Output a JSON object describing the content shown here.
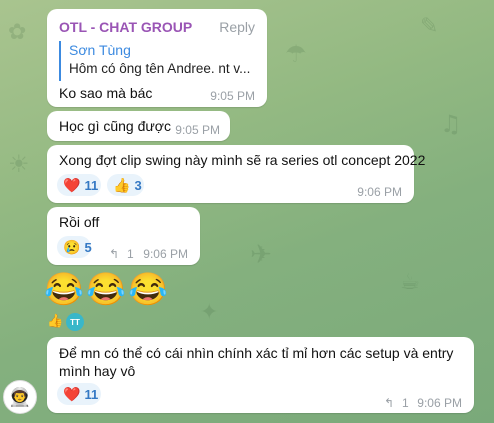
{
  "chat": {
    "messages": [
      {
        "sender": "OTL - CHAT GROUP",
        "reply_label": "Reply",
        "quote": {
          "name": "Sơn Tùng",
          "text": "Hôm có ông tên Andree. nt v..."
        },
        "text": "Ko sao mà bác",
        "time": "9:05 PM"
      },
      {
        "text": "Học gì cũng được",
        "time": "9:05 PM"
      },
      {
        "text": "Xong đợt clip swing này mình sẽ ra series otl concept 2022",
        "time": "9:06 PM",
        "reactions": [
          {
            "emoji": "❤️",
            "count": "11"
          },
          {
            "emoji": "👍",
            "count": "3"
          }
        ]
      },
      {
        "text": "Rồi off",
        "time": "9:06 PM",
        "reactions": [
          {
            "emoji": "😢",
            "count": "5"
          }
        ],
        "forwards": "1"
      },
      {
        "emojis": [
          "😂",
          "😂",
          "😂"
        ],
        "mini_reactions": [
          "👍",
          "TT"
        ]
      },
      {
        "text_line1": "Để mn có thể có cái nhìn chính xác tỉ mỉ hơn các setup và entry",
        "text_line2": "mình hay vô",
        "time": "9:06 PM",
        "reactions": [
          {
            "emoji": "❤️",
            "count": "11"
          }
        ],
        "forwards": "1"
      }
    ],
    "avatar_icon": "astronaut-icon",
    "forward_icon": "forward-arrow-icon",
    "colors": {
      "sender": "#9a55b5",
      "link": "#3c8ae0",
      "reaction_bg": "#e9f3fb"
    }
  }
}
